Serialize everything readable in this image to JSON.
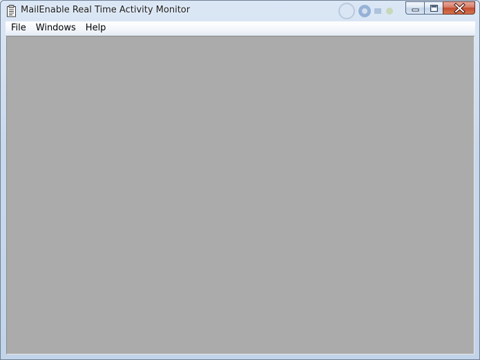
{
  "window": {
    "title": "MailEnable Real Time Activity Monitor",
    "app_icon": "clipboard-document-icon"
  },
  "caption_buttons": {
    "minimize_icon": "minimize-icon",
    "maximize_icon": "maximize-icon",
    "close_icon": "close-icon"
  },
  "menu": {
    "items": [
      {
        "label": "File"
      },
      {
        "label": "Windows"
      },
      {
        "label": "Help"
      }
    ]
  },
  "colors": {
    "client_background": "#ababab",
    "close_button": "#c7442b",
    "frame": "#c2d4ea"
  }
}
